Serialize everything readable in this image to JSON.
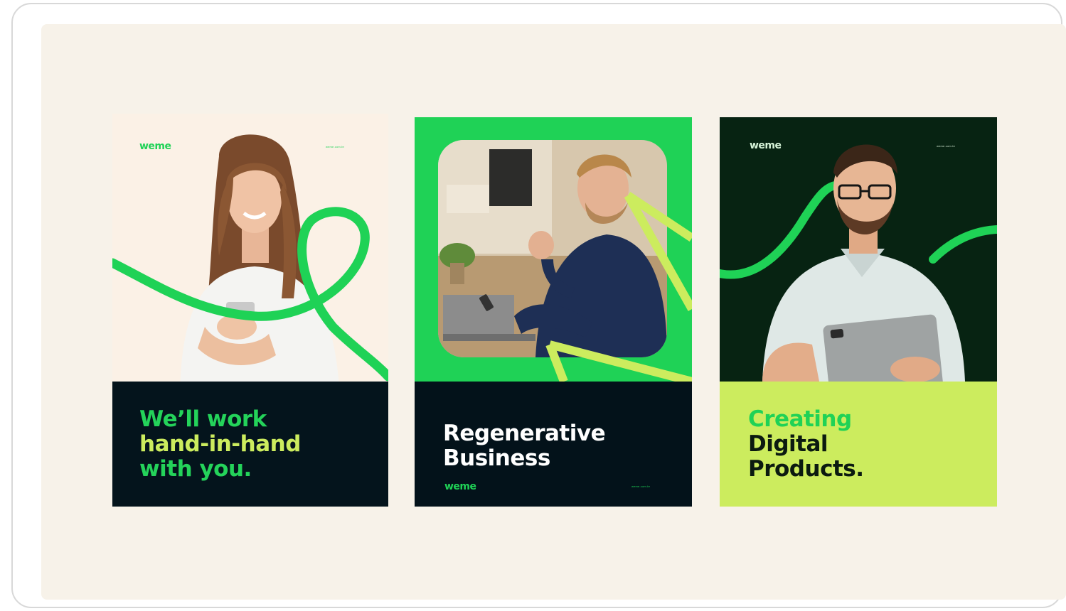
{
  "colors": {
    "canvas_bg": "#f7f2e9",
    "green": "#1fd256",
    "lime": "#ccec5e",
    "navy": "#04141c",
    "dark_green": "#072312",
    "cream": "#fbf1e6"
  },
  "posters": [
    {
      "logo": "weme",
      "url": "weme.com.br",
      "headline": [
        "We’ll work",
        "hand-in-hand",
        "with you."
      ]
    },
    {
      "logo": "weme",
      "url": "weme.com.br",
      "headline": [
        "Regenerative",
        "Business"
      ]
    },
    {
      "logo": "weme",
      "url": "weme.com.br",
      "headline": [
        "Creating",
        "Digital",
        "Products."
      ]
    }
  ]
}
